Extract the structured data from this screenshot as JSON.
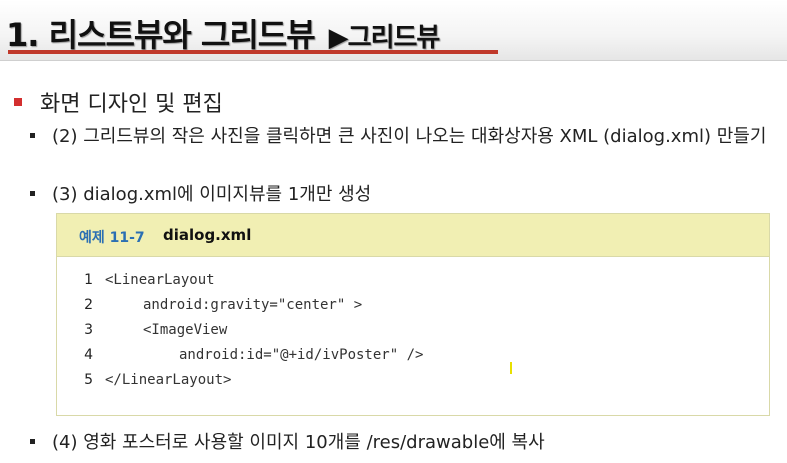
{
  "title": {
    "main": "1. 리스트뷰와 그리드뷰",
    "sub": "▶그리드뷰"
  },
  "section": {
    "heading": "화면 디자인 및 편집"
  },
  "bullets": [
    {
      "text": "(2) 그리드뷰의 작은 사진을 클릭하면 큰 사진이 나오는 대화상자용 XML (dialog.xml) 만들기"
    },
    {
      "text": "(3) dialog.xml에 이미지뷰를 1개만 생성"
    },
    {
      "text": "(4) 영화 포스터로 사용할 이미지 10개를 /res/drawable에 복사"
    }
  ],
  "example": {
    "label": "예제 11-7",
    "filename": "dialog.xml",
    "lines": [
      {
        "num": "1",
        "code": "<LinearLayout"
      },
      {
        "num": "2",
        "code": "android:gravity=\"center\" >"
      },
      {
        "num": "3",
        "code": "<ImageView"
      },
      {
        "num": "4",
        "code": "android:id=\"@+id/ivPoster\" />"
      },
      {
        "num": "5",
        "code": "</LinearLayout>"
      }
    ]
  },
  "colors": {
    "accent": "#c0392b",
    "code_header": "#f1efb3",
    "example_label": "#2b6fb3"
  }
}
